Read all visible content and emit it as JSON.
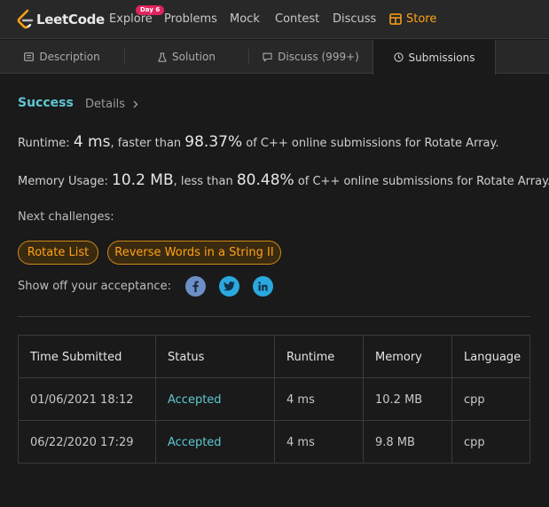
{
  "nav": {
    "logo_text": "LeetCode",
    "items": [
      "Explore",
      "Problems",
      "Mock",
      "Contest",
      "Discuss"
    ],
    "badge": "Day 6",
    "store": "Store"
  },
  "tabs": {
    "description": "Description",
    "solution": "Solution",
    "discuss": "Discuss (999+)",
    "submissions": "Submissions"
  },
  "result": {
    "status": "Success",
    "details": "Details",
    "runtime_label": "Runtime: ",
    "runtime_value": "4 ms",
    "runtime_mid": ", faster than ",
    "runtime_pct": "98.37%",
    "runtime_tail": " of C++ online submissions for Rotate Array.",
    "memory_label": "Memory Usage: ",
    "memory_value": "10.2 MB",
    "memory_mid": ", less than ",
    "memory_pct": "80.48%",
    "memory_tail": " of C++ online submissions for Rotate Array."
  },
  "challenges": {
    "label": "Next challenges:",
    "items": [
      "Rotate List",
      "Reverse Words in a String II"
    ]
  },
  "share": {
    "label": "Show off your acceptance:",
    "icons": [
      "facebook-icon",
      "twitter-icon",
      "linkedin-icon"
    ]
  },
  "table": {
    "headers": [
      "Time Submitted",
      "Status",
      "Runtime",
      "Memory",
      "Language"
    ],
    "rows": [
      [
        "01/06/2021 18:12",
        "Accepted",
        "4 ms",
        "10.2 MB",
        "cpp"
      ],
      [
        "06/22/2020 17:29",
        "Accepted",
        "4 ms",
        "9.8 MB",
        "cpp"
      ]
    ]
  },
  "colors": {
    "accent": "#ffa116",
    "success": "#5fc7d3",
    "background": "#1a1a1a",
    "badge": "#e0245e"
  }
}
